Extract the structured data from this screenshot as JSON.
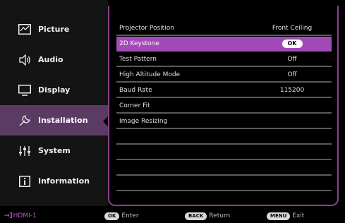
{
  "sidebar": {
    "items": [
      {
        "label": "Picture",
        "icon": "chart-line-icon"
      },
      {
        "label": "Audio",
        "icon": "speaker-icon"
      },
      {
        "label": "Display",
        "icon": "monitor-icon"
      },
      {
        "label": "Installation",
        "icon": "wrench-icon",
        "active": true
      },
      {
        "label": "System",
        "icon": "sliders-icon"
      },
      {
        "label": "Information",
        "icon": "info-icon"
      }
    ]
  },
  "settings": {
    "rows": [
      {
        "name": "Projector Position",
        "value": "Front Ceiling"
      },
      {
        "name": "2D Keystone",
        "value": "OK",
        "selected": true
      },
      {
        "name": "Test Pattern",
        "value": "Off"
      },
      {
        "name": "High Altitude Mode",
        "value": "Off"
      },
      {
        "name": "Baud Rate",
        "value": "115200"
      },
      {
        "name": "Corner Fit",
        "value": ""
      },
      {
        "name": "Image Resizing",
        "value": ""
      }
    ]
  },
  "footer": {
    "source": "HDMI-1",
    "ok_key": "OK",
    "ok_label": "Enter",
    "back_key": "BACK",
    "back_label": "Return",
    "menu_key": "MENU",
    "menu_label": "Exit"
  },
  "colors": {
    "accent": "#a24bb8",
    "active_tab": "#5b3a63",
    "frame": "#8a3f8f"
  }
}
